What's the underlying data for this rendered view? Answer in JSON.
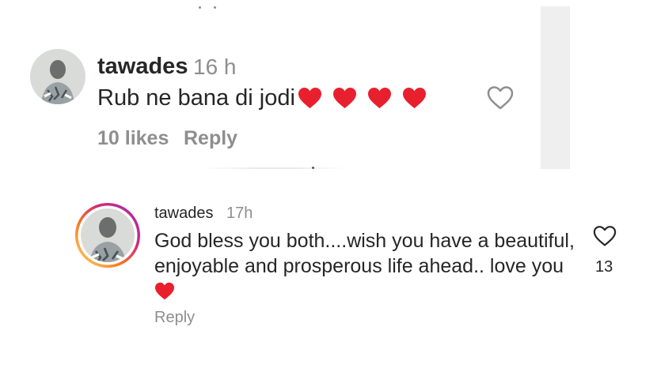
{
  "comment_1": {
    "username": "tawades",
    "time": "16 h",
    "text": "Rub ne bana di jodi",
    "emojis": [
      "heart-emoji",
      "heart-emoji",
      "heart-emoji",
      "heart-emoji"
    ],
    "likes": "10 likes",
    "reply_label": "Reply",
    "like_icon": "heart-outline-icon"
  },
  "comment_2": {
    "username": "tawades",
    "time": "17h",
    "text": "God bless you both....wish you have a beautiful, enjoyable and prosperous life ahead.. love you",
    "emoji": "heart-emoji",
    "reply_label": "Reply",
    "like_count": "13",
    "like_icon": "heart-outline-icon",
    "avatar_ring": "story-ring"
  },
  "colors": {
    "text_primary": "#262626",
    "text_secondary": "#8e8e8e",
    "heart_red": "#e8202e",
    "story_ring_start": "#feda75",
    "story_ring_mid": "#d62976",
    "story_ring_end": "#962fbf",
    "scroll_strip": "#efefef"
  }
}
